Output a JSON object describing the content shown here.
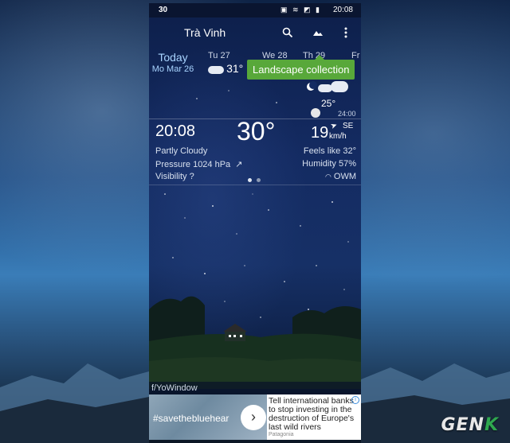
{
  "status_bar": {
    "left": "30",
    "icons": "▣ ≋ ◩ ▮",
    "time": "20:08"
  },
  "toolbar": {
    "city": "Trà Vinh",
    "search_icon": "search-icon",
    "landscape_icon": "landscape-icon",
    "menu_icon": "more-vert-icon"
  },
  "forecast": {
    "today": {
      "name": "Today",
      "date": "Mo Mar 26"
    },
    "days": [
      {
        "name": "Tu 27",
        "temp": "31°"
      },
      {
        "name": "We 28"
      },
      {
        "name": "Th 29"
      },
      {
        "name": "Fr"
      }
    ]
  },
  "tooltip": {
    "text": "Landscape collection"
  },
  "hourly": {
    "temp": "25°",
    "time": "24:00"
  },
  "current": {
    "time": "20:08",
    "temp": "30°",
    "wind_value": "19",
    "wind_dir": "SE",
    "wind_unit": "km/h",
    "condition": "Partly Cloudy",
    "feels_like": "Feels like 32°",
    "pressure": "Pressure 1024 hPa",
    "humidity": "Humidity 57%",
    "visibility": "Visibility ?",
    "provider": "OWM"
  },
  "credit": "f/YoWindow",
  "ad": {
    "hashtag": "#savethebluehear",
    "text": "Tell international banks to stop investing in the destruction of Europe's last wild rivers",
    "brand": "Patagonia",
    "next_icon": "chevron-right-icon",
    "info_icon": "info-icon"
  },
  "watermark": {
    "main": "GEN",
    "accent": "K"
  },
  "colors": {
    "tooltip": "#58a83a",
    "today": "#a8d4ff",
    "accent": "#2fa84f"
  }
}
